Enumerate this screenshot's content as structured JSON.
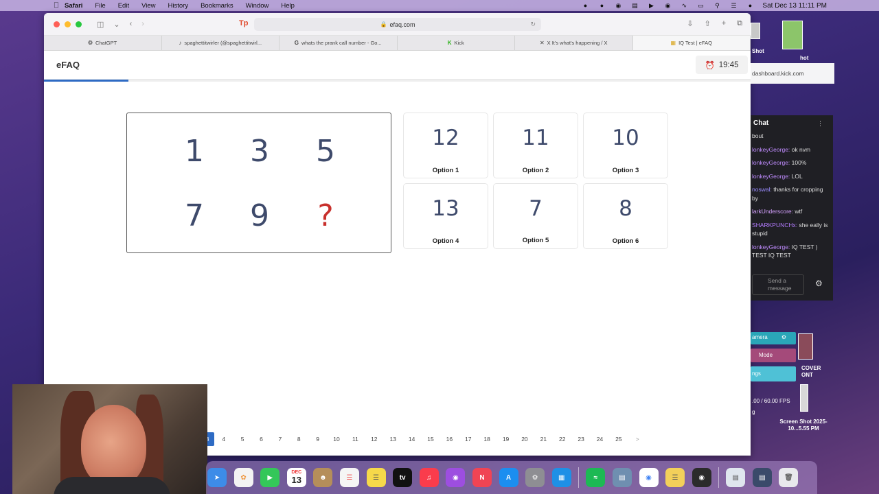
{
  "menubar": {
    "app": "Safari",
    "items": [
      "File",
      "Edit",
      "View",
      "History",
      "Bookmarks",
      "Window",
      "Help"
    ],
    "clock": "Sat Dec 13  11:11 PM"
  },
  "browser": {
    "url": "efaq.com",
    "tabs": [
      {
        "label": "ChatGPT",
        "icon": "openai-icon"
      },
      {
        "label": "spaghettitwirler (@spaghettitwirl...",
        "icon": "tiktok-icon"
      },
      {
        "label": "whats the prank call number - Go...",
        "icon": "google-icon"
      },
      {
        "label": "Kick",
        "icon": "kick-icon"
      },
      {
        "label": "X  It's what's happening / X",
        "icon": "x-icon"
      },
      {
        "label": "IQ Test | eFAQ",
        "icon": "efaq-icon",
        "active": true
      }
    ]
  },
  "page": {
    "brand": "eFAQ",
    "timer": "19:45",
    "progress_fraction": 0.12
  },
  "question": {
    "sequence": [
      "1",
      "3",
      "5",
      "7",
      "9",
      "?"
    ]
  },
  "options": [
    {
      "value": "12",
      "label": "Option 1"
    },
    {
      "value": "11",
      "label": "Option 2"
    },
    {
      "value": "10",
      "label": "Option 3"
    },
    {
      "value": "13",
      "label": "Option 4"
    },
    {
      "value": "7",
      "label": "Option 5"
    },
    {
      "value": "8",
      "label": "Option 6"
    }
  ],
  "pagination": {
    "current": "3",
    "pages": [
      "4",
      "5",
      "6",
      "7",
      "8",
      "9",
      "10",
      "11",
      "12",
      "13",
      "14",
      "15",
      "16",
      "17",
      "18",
      "19",
      "20",
      "21",
      "22",
      "23",
      "24",
      "25"
    ],
    "next": ">"
  },
  "stream": {
    "dashboard_url": "dashboard.kick.com",
    "chat_title": "Chat",
    "chat_messages": [
      {
        "user": "",
        "text": "bout"
      },
      {
        "user": "lonkeyGeorge:",
        "text": " ok nvm"
      },
      {
        "user": "lonkeyGeorge:",
        "text": " 100%"
      },
      {
        "user": "lonkeyGeorge:",
        "text": " LOL"
      },
      {
        "user": "noswal:",
        "text": " thanks for cropping by"
      },
      {
        "user": "larkUnderscore:",
        "text": " wtf"
      },
      {
        "user": "SHARKPUNCHx:",
        "text": " she eally is stupid"
      },
      {
        "user": "lonkeyGeorge:",
        "text": " IQ TEST ) TEST IQ TEST"
      }
    ],
    "send_placeholder": "Send a message",
    "obs": {
      "camera": "amera",
      "mode": "Mode",
      "ngs": "ngs",
      "fps": ".00 / 60.00 FPS",
      "cover": "COVER ONT",
      "g": "g"
    },
    "screenshot_label": "Screen Shot 2025-10...5.55 PM",
    "shot_top": "Shot",
    "hot_label": "hot"
  },
  "dock": {
    "calendar_month": "DEC",
    "calendar_day": "13"
  }
}
